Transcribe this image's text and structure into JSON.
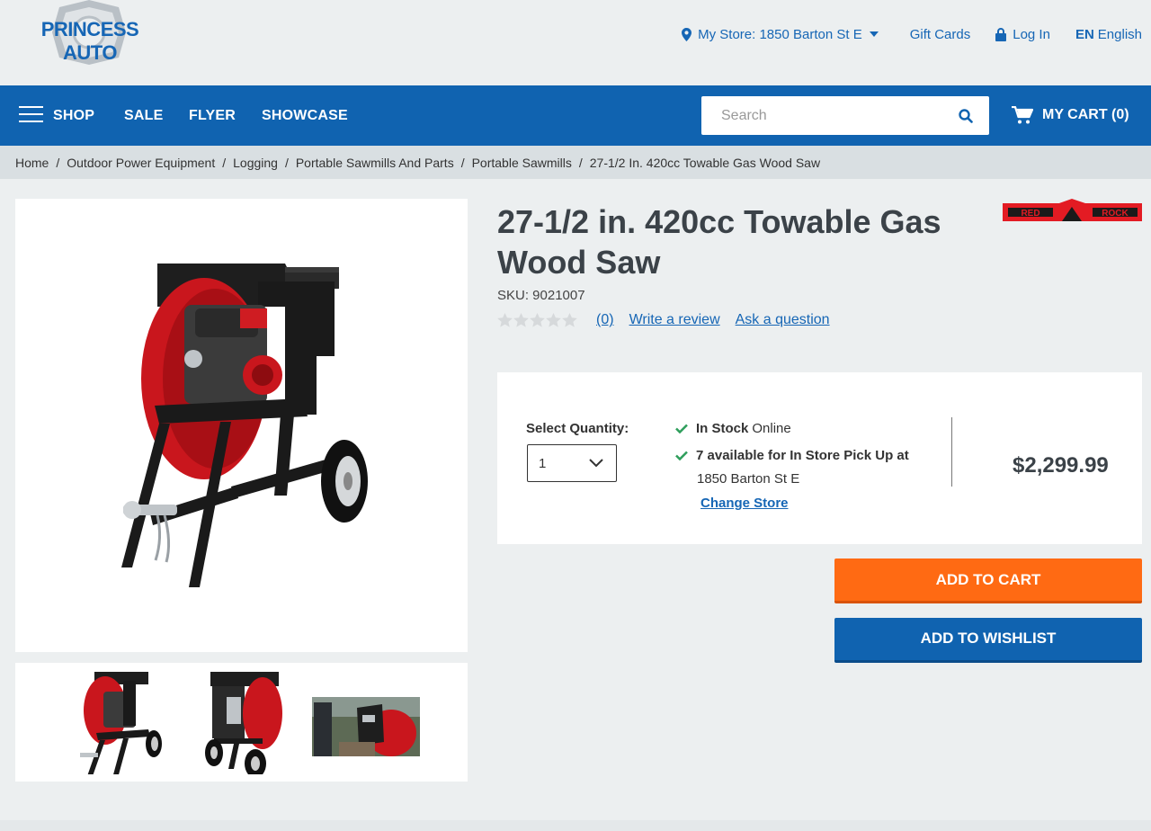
{
  "header": {
    "logo_text": "PRINCESS AUTO",
    "store_label": "My Store:",
    "store_name": "1850 Barton St E",
    "gift_cards": "Gift Cards",
    "login": "Log In",
    "lang_code": "EN",
    "lang_name": "English"
  },
  "nav": {
    "shop": "SHOP",
    "sale": "SALE",
    "flyer": "FLYER",
    "showcase": "SHOWCASE",
    "search_placeholder": "Search",
    "cart_label": "MY CART (0)"
  },
  "breadcrumb": [
    "Home",
    "Outdoor Power Equipment",
    "Logging",
    "Portable Sawmills And Parts",
    "Portable Sawmills",
    "27-1/2 In. 420cc Towable Gas Wood Saw"
  ],
  "breadcrumb_separator": "/",
  "product": {
    "title": "27-1/2 in. 420cc Towable Gas Wood Saw",
    "brand": "RED ROCK",
    "sku": "SKU: 9021007",
    "rating_stars": 0,
    "review_count": "(0)",
    "write_review": "Write a review",
    "ask_question": "Ask a question"
  },
  "purchase": {
    "qty_label": "Select Quantity:",
    "qty_value": "1",
    "stock_bold": "In Stock",
    "stock_rest": "Online",
    "pickup_bold": "7 available for In Store Pick Up at",
    "pickup_store": "1850 Barton St E",
    "change_store": "Change Store",
    "price": "$2,299.99"
  },
  "actions": {
    "add_to_cart": "ADD TO CART",
    "add_to_wishlist": "ADD TO WISHLIST"
  },
  "colors": {
    "brand_blue": "#1063b0",
    "link_blue": "#1666b5",
    "cart_orange": "#ff6a13",
    "stock_green": "#2e9e5b",
    "brand_red": "#e31b23"
  }
}
